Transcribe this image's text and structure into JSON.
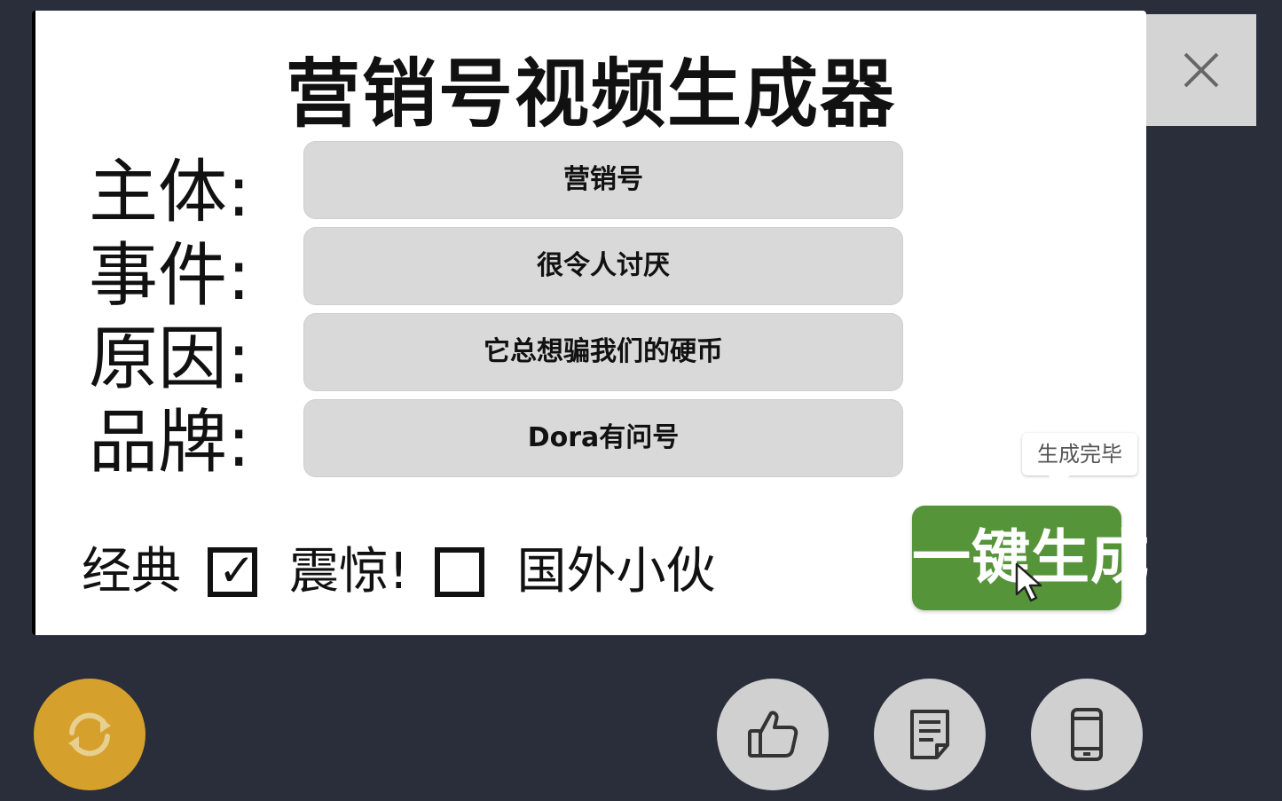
{
  "app": {
    "title": "营销号视频生成器"
  },
  "fields": [
    {
      "label": "主体:",
      "value": "营销号"
    },
    {
      "label": "事件:",
      "value": "很令人讨厌"
    },
    {
      "label": "原因:",
      "value": "它总想骗我们的硬币"
    },
    {
      "label": "品牌:",
      "value": "Dora有问号"
    }
  ],
  "tags": [
    {
      "label": "经典",
      "checked": true
    },
    {
      "label": "震惊!",
      "checked": false
    },
    {
      "label": "国外小伙"
    }
  ],
  "tooltip": {
    "text": "生成完毕"
  },
  "generate_button": {
    "label": "一键生成",
    "color": "#56943a"
  },
  "close_button": {
    "icon": "close-icon"
  },
  "bottom_bar": {
    "refresh": {
      "icon": "refresh-icon",
      "color": "#d5a12c"
    },
    "like": {
      "icon": "thumbs-up-icon"
    },
    "notes": {
      "icon": "document-icon"
    },
    "phone": {
      "icon": "phone-icon"
    }
  },
  "colors": {
    "background": "#2a2d3a",
    "panel": "#ffffff",
    "input": "#d9d9d9",
    "round_button": "#d0d0d0"
  }
}
